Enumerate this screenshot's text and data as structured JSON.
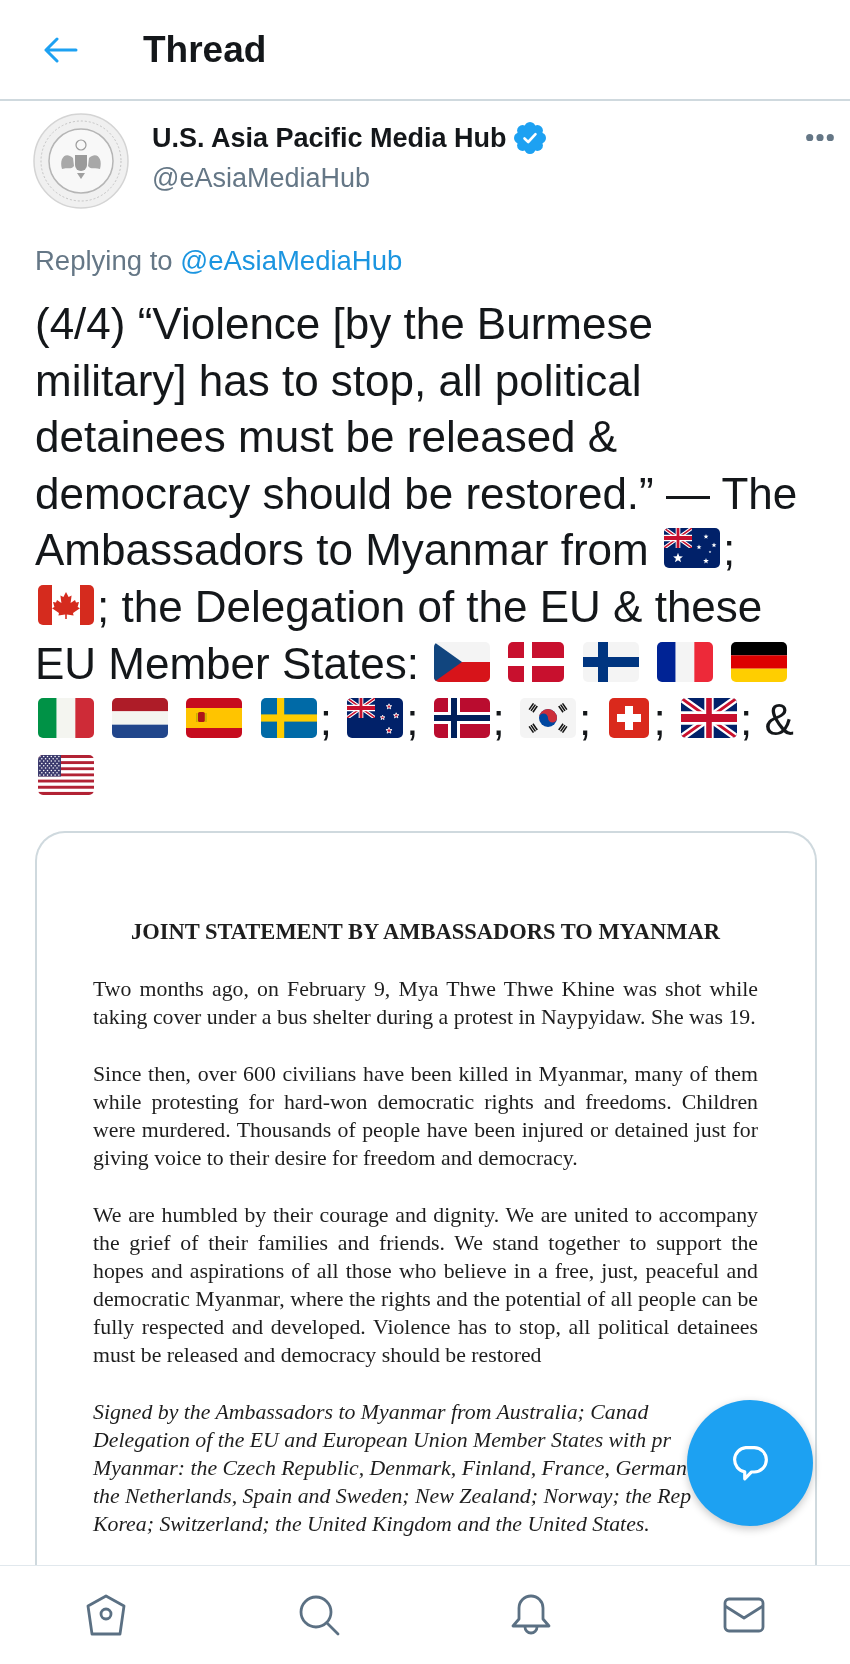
{
  "header": {
    "title": "Thread"
  },
  "author": {
    "name": "U.S. Asia Pacific Media Hub",
    "verified": true,
    "handle": "@eAsiaMediaHub"
  },
  "replying_to": {
    "label": "Replying to",
    "mention": "@eAsiaMediaHub"
  },
  "tweet": {
    "segments": [
      {
        "kind": "text",
        "text": "(4/4) “Violence [by the Burmese military] has to stop, all political detainees must be released & democracy should be restored.” — The Ambassadors to Myanmar from "
      },
      {
        "kind": "australia"
      },
      {
        "kind": "text",
        "text": "; "
      },
      {
        "kind": "canada"
      },
      {
        "kind": "text",
        "text": "; the Delegation of the EU & these EU Member States: "
      },
      {
        "kind": "czechia"
      },
      {
        "kind": "denmark"
      },
      {
        "kind": "finland"
      },
      {
        "kind": "france"
      },
      {
        "kind": "germany"
      },
      {
        "kind": "italy"
      },
      {
        "kind": "netherlands"
      },
      {
        "kind": "spain"
      },
      {
        "kind": "sweden"
      },
      {
        "kind": "text",
        "text": "; "
      },
      {
        "kind": "newzealand"
      },
      {
        "kind": "text",
        "text": "; "
      },
      {
        "kind": "norway"
      },
      {
        "kind": "text",
        "text": "; "
      },
      {
        "kind": "southkorea"
      },
      {
        "kind": "text",
        "text": "; "
      },
      {
        "kind": "switzerland"
      },
      {
        "kind": "text",
        "text": "; "
      },
      {
        "kind": "unitedkingdom"
      },
      {
        "kind": "text",
        "text": "; & "
      },
      {
        "kind": "unitedstates"
      }
    ]
  },
  "attachment": {
    "title": "JOINT STATEMENT BY AMBASSADORS TO MYANMAR",
    "paragraphs": [
      "Two months ago, on February 9, Mya Thwe Thwe Khine was shot while taking cover under a bus shelter during a protest in Naypyidaw. She was 19.",
      "Since then, over 600 civilians have been killed in Myanmar, many of them while protesting for hard-won democratic rights and freedoms. Children were murdered. Thousands of people have been injured or detained just for giving voice to their desire for freedom and democracy.",
      "We are humbled by their courage and dignity. We are united to accompany the grief of their families and friends. We stand together to support the hopes and aspirations of all those who believe in a free, just, peaceful and democratic Myanmar, where the rights and the potential of all people can be fully respected and developed. Violence has to stop, all political detainees must be released and democracy should be restored"
    ],
    "signature_lines": [
      "Signed by the Ambassadors to Myanmar from Australia; Canad",
      "Delegation of the EU and European Union Member States with pr",
      "Myanmar: the Czech Republic, Denmark, Finland, France, German",
      "the Netherlands, Spain and Sweden; New Zealand; Norway; the Rep",
      "Korea; Switzerland; the United Kingdom and the United States."
    ]
  },
  "bottom_nav": {
    "items": [
      {
        "kind": "home",
        "selected": false
      },
      {
        "kind": "search",
        "selected": false
      },
      {
        "kind": "notifications",
        "selected": false
      },
      {
        "kind": "messages",
        "selected": false
      }
    ]
  }
}
